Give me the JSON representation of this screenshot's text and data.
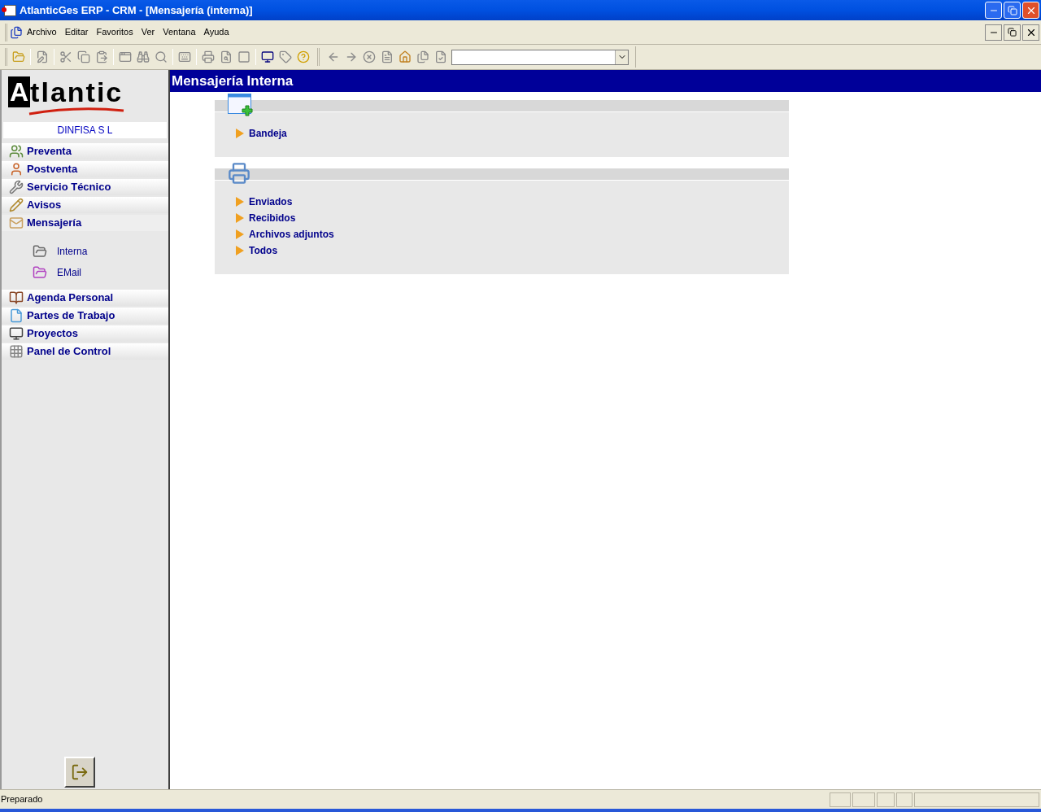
{
  "window": {
    "title": "AtlanticGes ERP - CRM - [Mensajería (interna)]"
  },
  "menu": [
    "Archivo",
    "Editar",
    "Favoritos",
    "Ver",
    "Ventana",
    "Ayuda"
  ],
  "sidebar": {
    "company": "DINFISA  S L",
    "items": [
      {
        "label": "Preventa",
        "expanded": false
      },
      {
        "label": "Postventa",
        "expanded": false
      },
      {
        "label": "Servicio Técnico",
        "expanded": false
      },
      {
        "label": "Avisos",
        "expanded": false
      },
      {
        "label": "Mensajería",
        "expanded": true,
        "children": [
          {
            "label": "Interna"
          },
          {
            "label": "EMail"
          }
        ]
      },
      {
        "label": "Agenda Personal",
        "expanded": false
      },
      {
        "label": "Partes de Trabajo",
        "expanded": false
      },
      {
        "label": "Proyectos",
        "expanded": false
      },
      {
        "label": "Panel de Control",
        "expanded": false
      }
    ]
  },
  "logo": {
    "mark": "A",
    "text": "tlantic"
  },
  "content": {
    "title": "Mensajería Interna",
    "sections": [
      {
        "links": [
          "Bandeja"
        ]
      },
      {
        "links": [
          "Enviados",
          "Recibidos",
          "Archivos adjuntos",
          "Todos"
        ]
      }
    ]
  },
  "status_bar": {
    "text": "Preparado"
  }
}
